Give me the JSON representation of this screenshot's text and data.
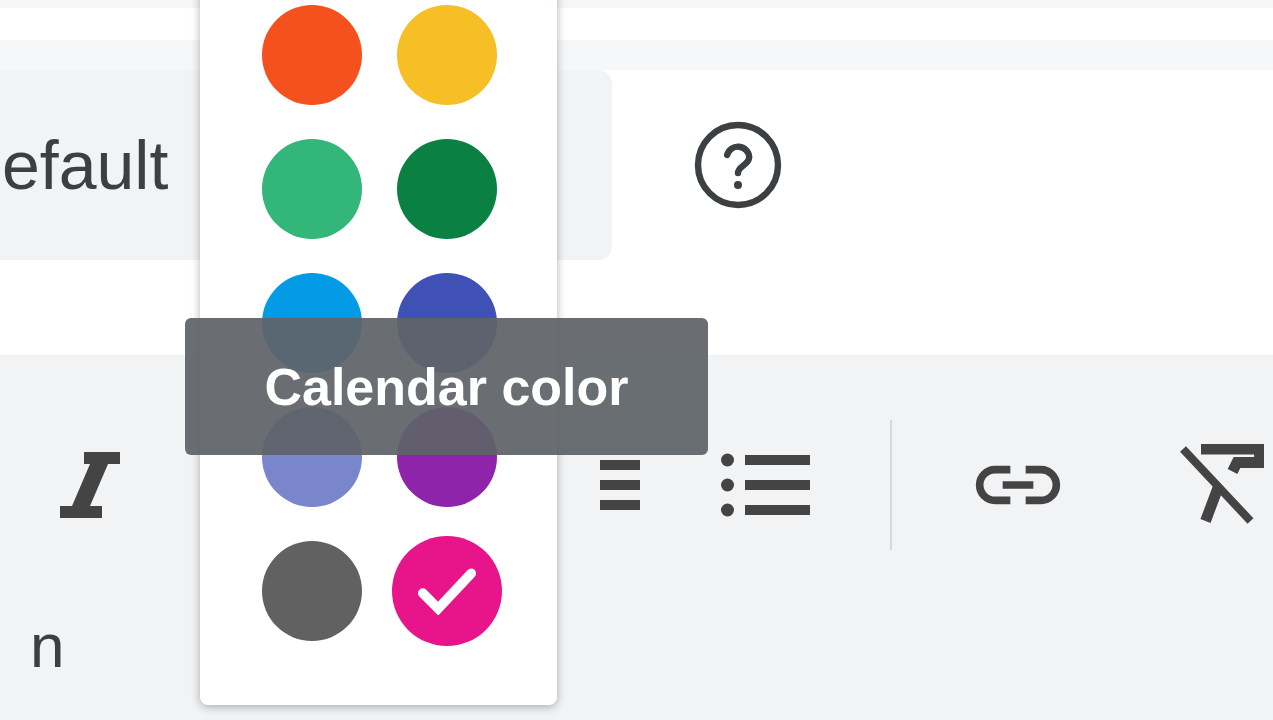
{
  "calendar_field": {
    "value": "efault"
  },
  "description_fragment": "n",
  "color_picker": {
    "swatches": [
      {
        "color": "#f4511e",
        "selected": false
      },
      {
        "color": "#f6bf26",
        "selected": false
      },
      {
        "color": "#33b679",
        "selected": false
      },
      {
        "color": "#0b8043",
        "selected": false
      },
      {
        "color": "#039be5",
        "selected": false
      },
      {
        "color": "#3f51b5",
        "selected": false
      },
      {
        "color": "#7986cb",
        "selected": false
      },
      {
        "color": "#8e24aa",
        "selected": false
      },
      {
        "color": "#616161",
        "selected": false
      },
      {
        "color": "#e7148a",
        "selected": true
      }
    ]
  },
  "tooltip": {
    "text": "Calendar color"
  }
}
